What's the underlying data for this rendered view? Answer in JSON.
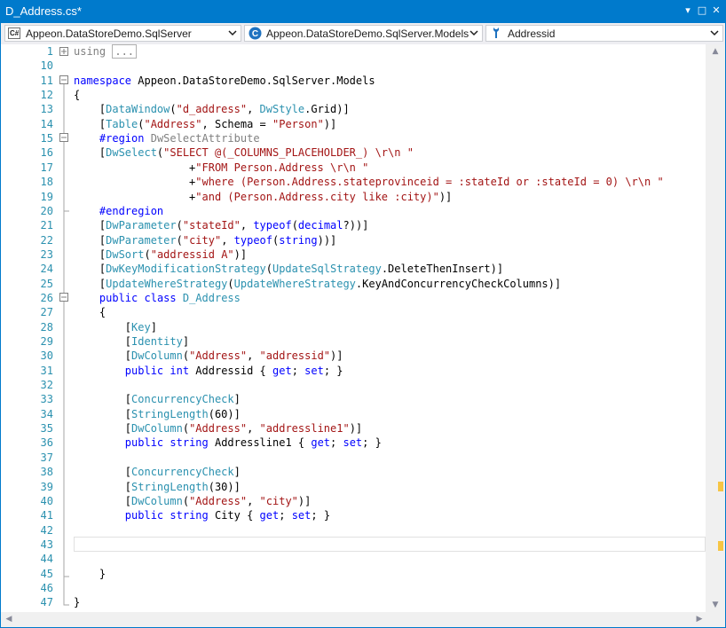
{
  "window": {
    "title": "D_Address.cs*",
    "buttons": {
      "dropdown": "▾",
      "maximize": "□",
      "close": "✕"
    }
  },
  "nav": {
    "project": {
      "icon": "C#",
      "text": "Appeon.DataStoreDemo.SqlServer"
    },
    "type": {
      "icon": "C",
      "text": "Appeon.DataStoreDemo.SqlServer.Models"
    },
    "member": {
      "text": "Addressid"
    }
  },
  "editor": {
    "line_numbers": [
      "1",
      "10",
      "11",
      "12",
      "13",
      "14",
      "15",
      "16",
      "17",
      "18",
      "19",
      "20",
      "21",
      "22",
      "23",
      "24",
      "25",
      "26",
      "27",
      "28",
      "29",
      "30",
      "31",
      "32",
      "33",
      "34",
      "35",
      "36",
      "37",
      "38",
      "39",
      "40",
      "41",
      "42",
      "43",
      "44",
      "45",
      "46",
      "47"
    ],
    "lines": [
      [
        {
          "t": "using",
          "c": "gr"
        },
        {
          "t": " "
        },
        {
          "t": "...",
          "c": "coll"
        }
      ],
      [],
      [
        {
          "t": "namespace",
          "c": "kw"
        },
        {
          "t": " Appeon.DataStoreDemo.SqlServer.Models"
        }
      ],
      [
        {
          "t": "{"
        }
      ],
      [
        {
          "t": "    ["
        },
        {
          "t": "DataWindow",
          "c": "ty"
        },
        {
          "t": "("
        },
        {
          "t": "\"d_address\"",
          "c": "st"
        },
        {
          "t": ", "
        },
        {
          "t": "DwStyle",
          "c": "ty"
        },
        {
          "t": ".Grid)]"
        }
      ],
      [
        {
          "t": "    ["
        },
        {
          "t": "Table",
          "c": "ty"
        },
        {
          "t": "("
        },
        {
          "t": "\"Address\"",
          "c": "st"
        },
        {
          "t": ", Schema = "
        },
        {
          "t": "\"Person\"",
          "c": "st"
        },
        {
          "t": ")]"
        }
      ],
      [
        {
          "t": "    "
        },
        {
          "t": "#region",
          "c": "kw"
        },
        {
          "t": " "
        },
        {
          "t": "DwSelectAttribute",
          "c": "gr"
        }
      ],
      [
        {
          "t": "    ["
        },
        {
          "t": "DwSelect",
          "c": "ty"
        },
        {
          "t": "("
        },
        {
          "t": "\"SELECT @(_COLUMNS_PLACEHOLDER_) \\r\\n \"",
          "c": "st"
        }
      ],
      [
        {
          "t": "                  +"
        },
        {
          "t": "\"FROM Person.Address \\r\\n \"",
          "c": "st"
        }
      ],
      [
        {
          "t": "                  +"
        },
        {
          "t": "\"where (Person.Address.stateprovinceid = :stateId or :stateId = 0) \\r\\n \"",
          "c": "st"
        }
      ],
      [
        {
          "t": "                  +"
        },
        {
          "t": "\"and (Person.Address.city like :city)\"",
          "c": "st"
        },
        {
          "t": ")]"
        }
      ],
      [
        {
          "t": "    "
        },
        {
          "t": "#endregion",
          "c": "kw"
        }
      ],
      [
        {
          "t": "    ["
        },
        {
          "t": "DwParameter",
          "c": "ty"
        },
        {
          "t": "("
        },
        {
          "t": "\"stateId\"",
          "c": "st"
        },
        {
          "t": ", "
        },
        {
          "t": "typeof",
          "c": "kw"
        },
        {
          "t": "("
        },
        {
          "t": "decimal",
          "c": "kw"
        },
        {
          "t": "?))]"
        }
      ],
      [
        {
          "t": "    ["
        },
        {
          "t": "DwParameter",
          "c": "ty"
        },
        {
          "t": "("
        },
        {
          "t": "\"city\"",
          "c": "st"
        },
        {
          "t": ", "
        },
        {
          "t": "typeof",
          "c": "kw"
        },
        {
          "t": "("
        },
        {
          "t": "string",
          "c": "kw"
        },
        {
          "t": "))]"
        }
      ],
      [
        {
          "t": "    ["
        },
        {
          "t": "DwSort",
          "c": "ty"
        },
        {
          "t": "("
        },
        {
          "t": "\"addressid A\"",
          "c": "st"
        },
        {
          "t": ")]"
        }
      ],
      [
        {
          "t": "    ["
        },
        {
          "t": "DwKeyModificationStrategy",
          "c": "ty"
        },
        {
          "t": "("
        },
        {
          "t": "UpdateSqlStrategy",
          "c": "ty"
        },
        {
          "t": ".DeleteThenInsert)]"
        }
      ],
      [
        {
          "t": "    ["
        },
        {
          "t": "UpdateWhereStrategy",
          "c": "ty"
        },
        {
          "t": "("
        },
        {
          "t": "UpdateWhereStrategy",
          "c": "ty"
        },
        {
          "t": ".KeyAndConcurrencyCheckColumns)]"
        }
      ],
      [
        {
          "t": "    "
        },
        {
          "t": "public",
          "c": "kw"
        },
        {
          "t": " "
        },
        {
          "t": "class",
          "c": "kw"
        },
        {
          "t": " "
        },
        {
          "t": "D_Address",
          "c": "ty"
        }
      ],
      [
        {
          "t": "    {"
        }
      ],
      [
        {
          "t": "        ["
        },
        {
          "t": "Key",
          "c": "ty"
        },
        {
          "t": "]"
        }
      ],
      [
        {
          "t": "        ["
        },
        {
          "t": "Identity",
          "c": "ty"
        },
        {
          "t": "]"
        }
      ],
      [
        {
          "t": "        ["
        },
        {
          "t": "DwColumn",
          "c": "ty"
        },
        {
          "t": "("
        },
        {
          "t": "\"Address\"",
          "c": "st"
        },
        {
          "t": ", "
        },
        {
          "t": "\"addressid\"",
          "c": "st"
        },
        {
          "t": ")]"
        }
      ],
      [
        {
          "t": "        "
        },
        {
          "t": "public",
          "c": "kw"
        },
        {
          "t": " "
        },
        {
          "t": "int",
          "c": "kw"
        },
        {
          "t": " Addressid { "
        },
        {
          "t": "get",
          "c": "kw"
        },
        {
          "t": "; "
        },
        {
          "t": "set",
          "c": "kw"
        },
        {
          "t": "; }"
        }
      ],
      [],
      [
        {
          "t": "        ["
        },
        {
          "t": "ConcurrencyCheck",
          "c": "ty"
        },
        {
          "t": "]"
        }
      ],
      [
        {
          "t": "        ["
        },
        {
          "t": "StringLength",
          "c": "ty"
        },
        {
          "t": "(60)]"
        }
      ],
      [
        {
          "t": "        ["
        },
        {
          "t": "DwColumn",
          "c": "ty"
        },
        {
          "t": "("
        },
        {
          "t": "\"Address\"",
          "c": "st"
        },
        {
          "t": ", "
        },
        {
          "t": "\"addressline1\"",
          "c": "st"
        },
        {
          "t": ")]"
        }
      ],
      [
        {
          "t": "        "
        },
        {
          "t": "public",
          "c": "kw"
        },
        {
          "t": " "
        },
        {
          "t": "string",
          "c": "kw"
        },
        {
          "t": " Addressline1 { "
        },
        {
          "t": "get",
          "c": "kw"
        },
        {
          "t": "; "
        },
        {
          "t": "set",
          "c": "kw"
        },
        {
          "t": "; }"
        }
      ],
      [],
      [
        {
          "t": "        ["
        },
        {
          "t": "ConcurrencyCheck",
          "c": "ty"
        },
        {
          "t": "]"
        }
      ],
      [
        {
          "t": "        ["
        },
        {
          "t": "StringLength",
          "c": "ty"
        },
        {
          "t": "(30)]"
        }
      ],
      [
        {
          "t": "        ["
        },
        {
          "t": "DwColumn",
          "c": "ty"
        },
        {
          "t": "("
        },
        {
          "t": "\"Address\"",
          "c": "st"
        },
        {
          "t": ", "
        },
        {
          "t": "\"city\"",
          "c": "st"
        },
        {
          "t": ")]"
        }
      ],
      [
        {
          "t": "        "
        },
        {
          "t": "public",
          "c": "kw"
        },
        {
          "t": " "
        },
        {
          "t": "string",
          "c": "kw"
        },
        {
          "t": " City { "
        },
        {
          "t": "get",
          "c": "kw"
        },
        {
          "t": "; "
        },
        {
          "t": "set",
          "c": "kw"
        },
        {
          "t": "; }"
        }
      ],
      [],
      [],
      [],
      [
        {
          "t": "    }"
        }
      ],
      [],
      [
        {
          "t": "}"
        }
      ]
    ]
  },
  "colors": {
    "accent": "#007acc",
    "keyword": "#0000ff",
    "type": "#2b91af",
    "string": "#a31515",
    "comment": "#808080"
  }
}
